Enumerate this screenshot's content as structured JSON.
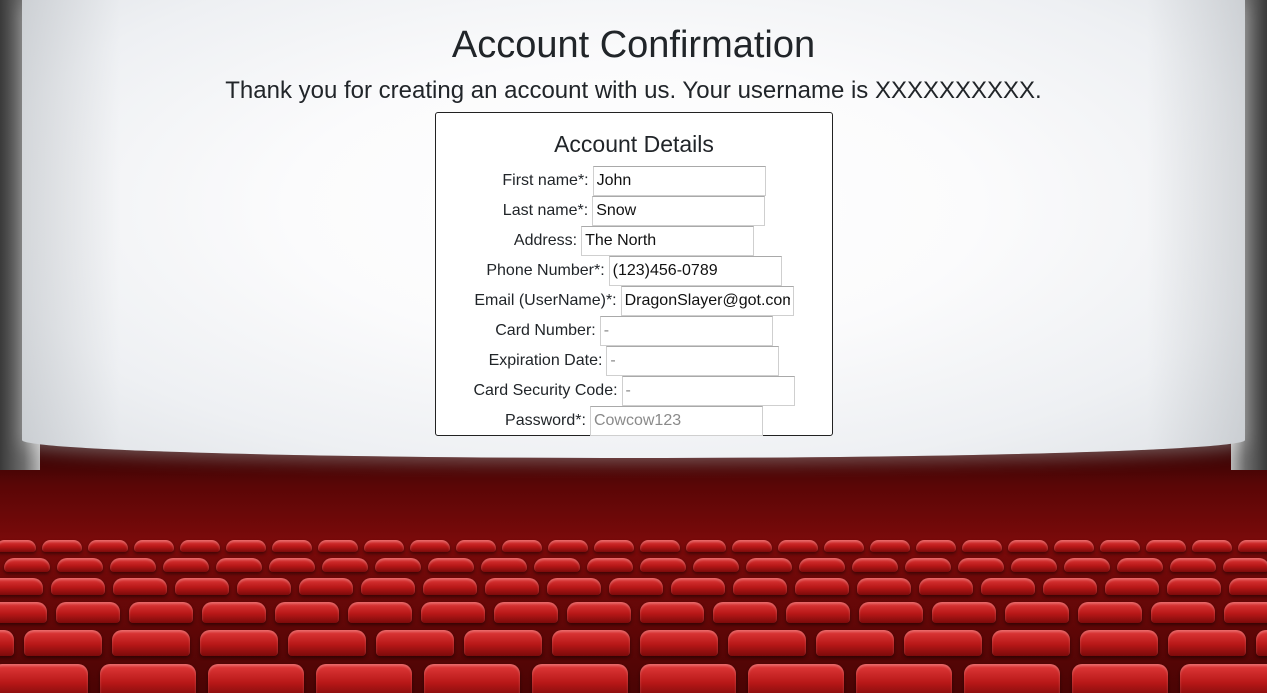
{
  "page": {
    "title": "Account Confirmation",
    "message": "Thank you for creating an account with us. Your username is XXXXXXXXXX."
  },
  "details": {
    "title": "Account Details",
    "fields": [
      {
        "label": "First name*:",
        "value": "John",
        "placeholder": ""
      },
      {
        "label": "Last name*:",
        "value": "Snow",
        "placeholder": ""
      },
      {
        "label": "Address:",
        "value": "The North",
        "placeholder": ""
      },
      {
        "label": "Phone Number*:",
        "value": "(123)456-0789",
        "placeholder": ""
      },
      {
        "label": "Email (UserName)*:",
        "value": "DragonSlayer@got.com",
        "placeholder": ""
      },
      {
        "label": "Card Number:",
        "value": "",
        "placeholder": "-"
      },
      {
        "label": "Expiration Date:",
        "value": "",
        "placeholder": "-"
      },
      {
        "label": "Card Security Code:",
        "value": "",
        "placeholder": "-"
      },
      {
        "label": "Password*:",
        "value": "",
        "placeholder": "Cowcow123"
      }
    ]
  },
  "colors": {
    "seat_red": "#c41e1e",
    "panel_border": "#222222",
    "text": "#212529"
  }
}
